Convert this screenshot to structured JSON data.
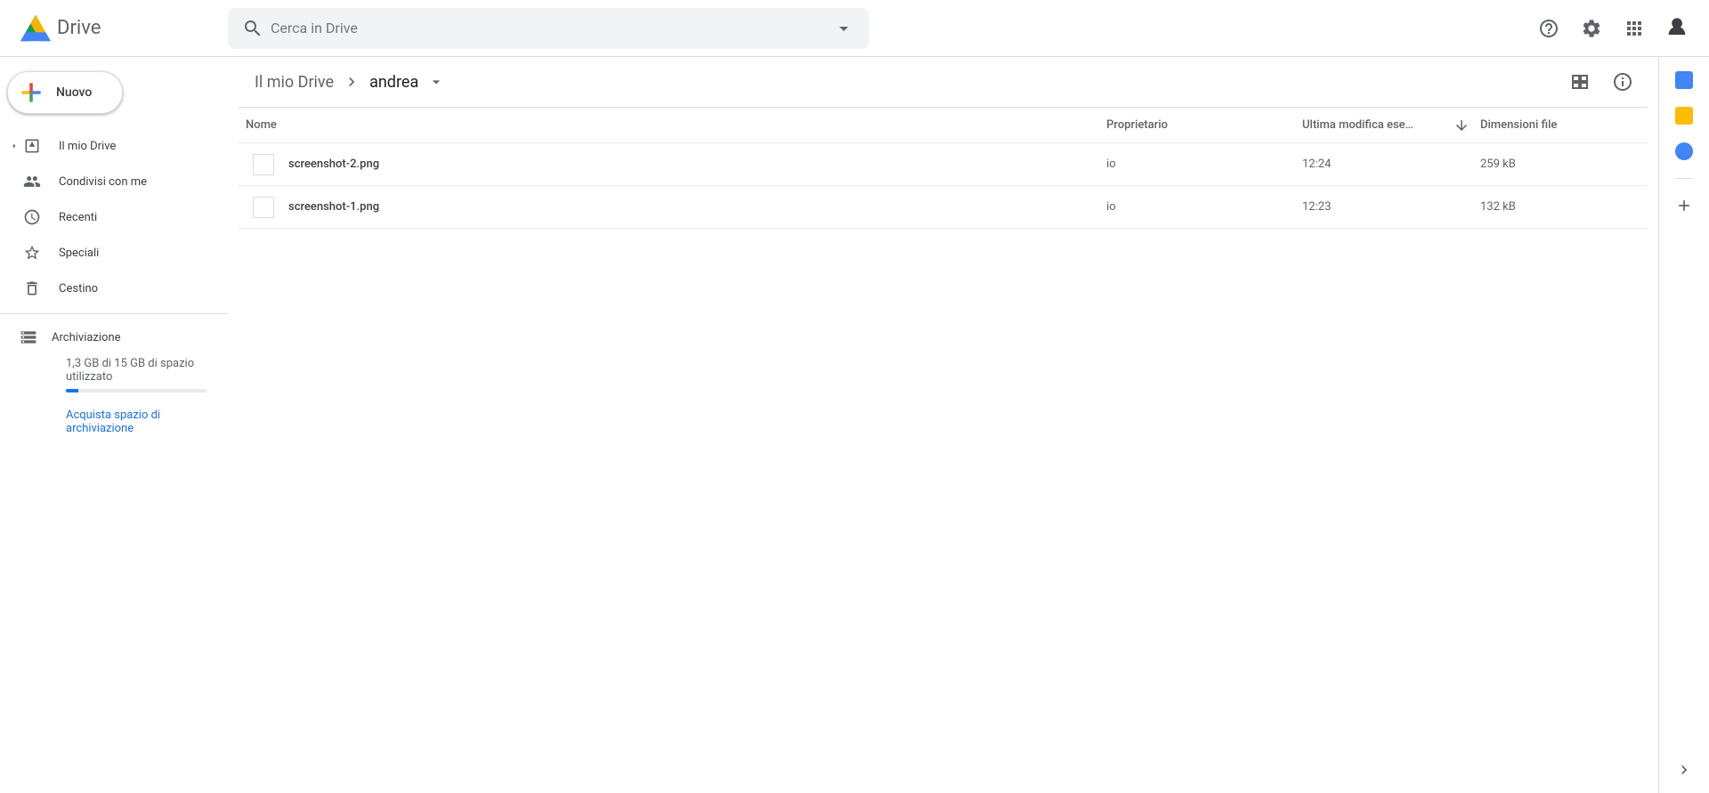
{
  "header": {
    "app_name": "Drive",
    "search_placeholder": "Cerca in Drive"
  },
  "new_button": {
    "label": "Nuovo"
  },
  "sidebar": {
    "items": [
      {
        "label": "Il mio Drive"
      },
      {
        "label": "Condivisi con me"
      },
      {
        "label": "Recenti"
      },
      {
        "label": "Speciali"
      },
      {
        "label": "Cestino"
      }
    ],
    "storage": {
      "title": "Archiviazione",
      "text": "1,3 GB di 15 GB di spazio utilizzato",
      "buy_link": "Acquista spazio di archiviazione"
    }
  },
  "breadcrumb": {
    "root": "Il mio Drive",
    "current": "andrea"
  },
  "columns": {
    "name": "Nome",
    "owner": "Proprietario",
    "modified": "Ultima modifica ese…",
    "size": "Dimensioni file"
  },
  "files": [
    {
      "name": "screenshot-2.png",
      "owner": "io",
      "modified": "12:24",
      "size": "259 kB"
    },
    {
      "name": "screenshot-1.png",
      "owner": "io",
      "modified": "12:23",
      "size": "132 kB"
    }
  ]
}
